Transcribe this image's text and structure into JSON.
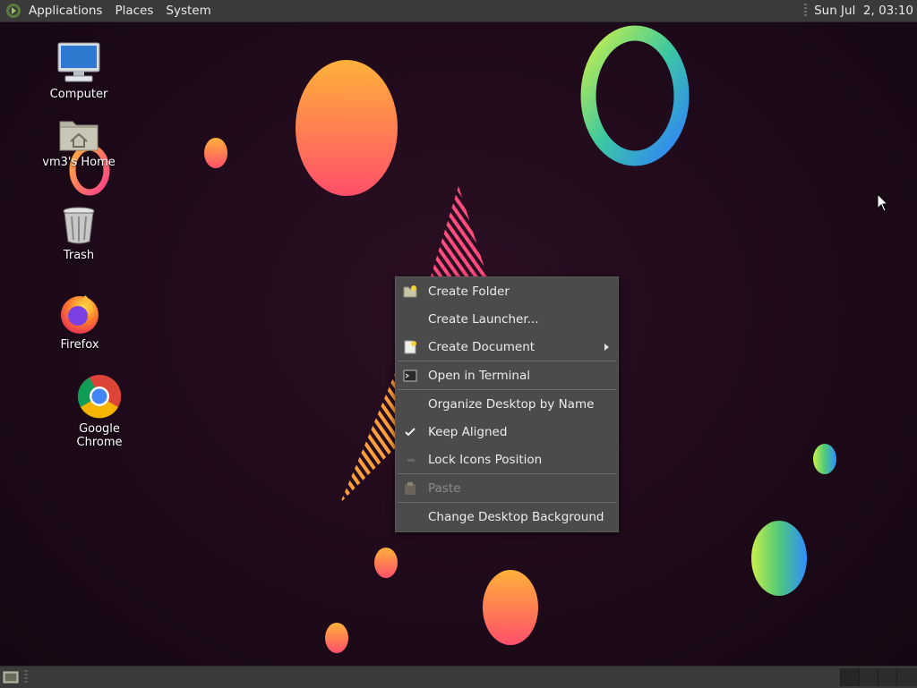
{
  "top_panel": {
    "menus": [
      "Applications",
      "Places",
      "System"
    ],
    "clock": "Sun Jul  2, 03:10"
  },
  "desktop_icons": [
    {
      "label": "Computer",
      "icon": "computer-icon"
    },
    {
      "label": "vm3's Home",
      "icon": "home-folder-icon"
    },
    {
      "label": "Trash",
      "icon": "trash-icon"
    },
    {
      "label": "Firefox",
      "icon": "firefox-icon"
    },
    {
      "label": "Google Chrome",
      "icon": "chrome-icon"
    }
  ],
  "context_menu": {
    "items": [
      {
        "label": "Create Folder",
        "icon": "folder-new-icon",
        "enabled": true
      },
      {
        "label": "Create Launcher...",
        "enabled": true
      },
      {
        "label": "Create Document",
        "icon": "document-new-icon",
        "submenu": true,
        "enabled": true
      },
      {
        "label": "Open in Terminal",
        "icon": "terminal-icon",
        "enabled": true
      },
      {
        "label": "Organize Desktop by Name",
        "enabled": true
      },
      {
        "label": "Keep Aligned",
        "checked": true,
        "enabled": true
      },
      {
        "label": "Lock Icons Position",
        "checked": false,
        "enabled": true
      },
      {
        "label": "Paste",
        "icon": "paste-icon",
        "enabled": false
      },
      {
        "label": "Change Desktop Background",
        "enabled": true
      }
    ]
  },
  "colors": {
    "panel": "#3a3a3a",
    "menu_bg": "#4b4b4b",
    "desktop_bg": "#1e0a1a"
  }
}
